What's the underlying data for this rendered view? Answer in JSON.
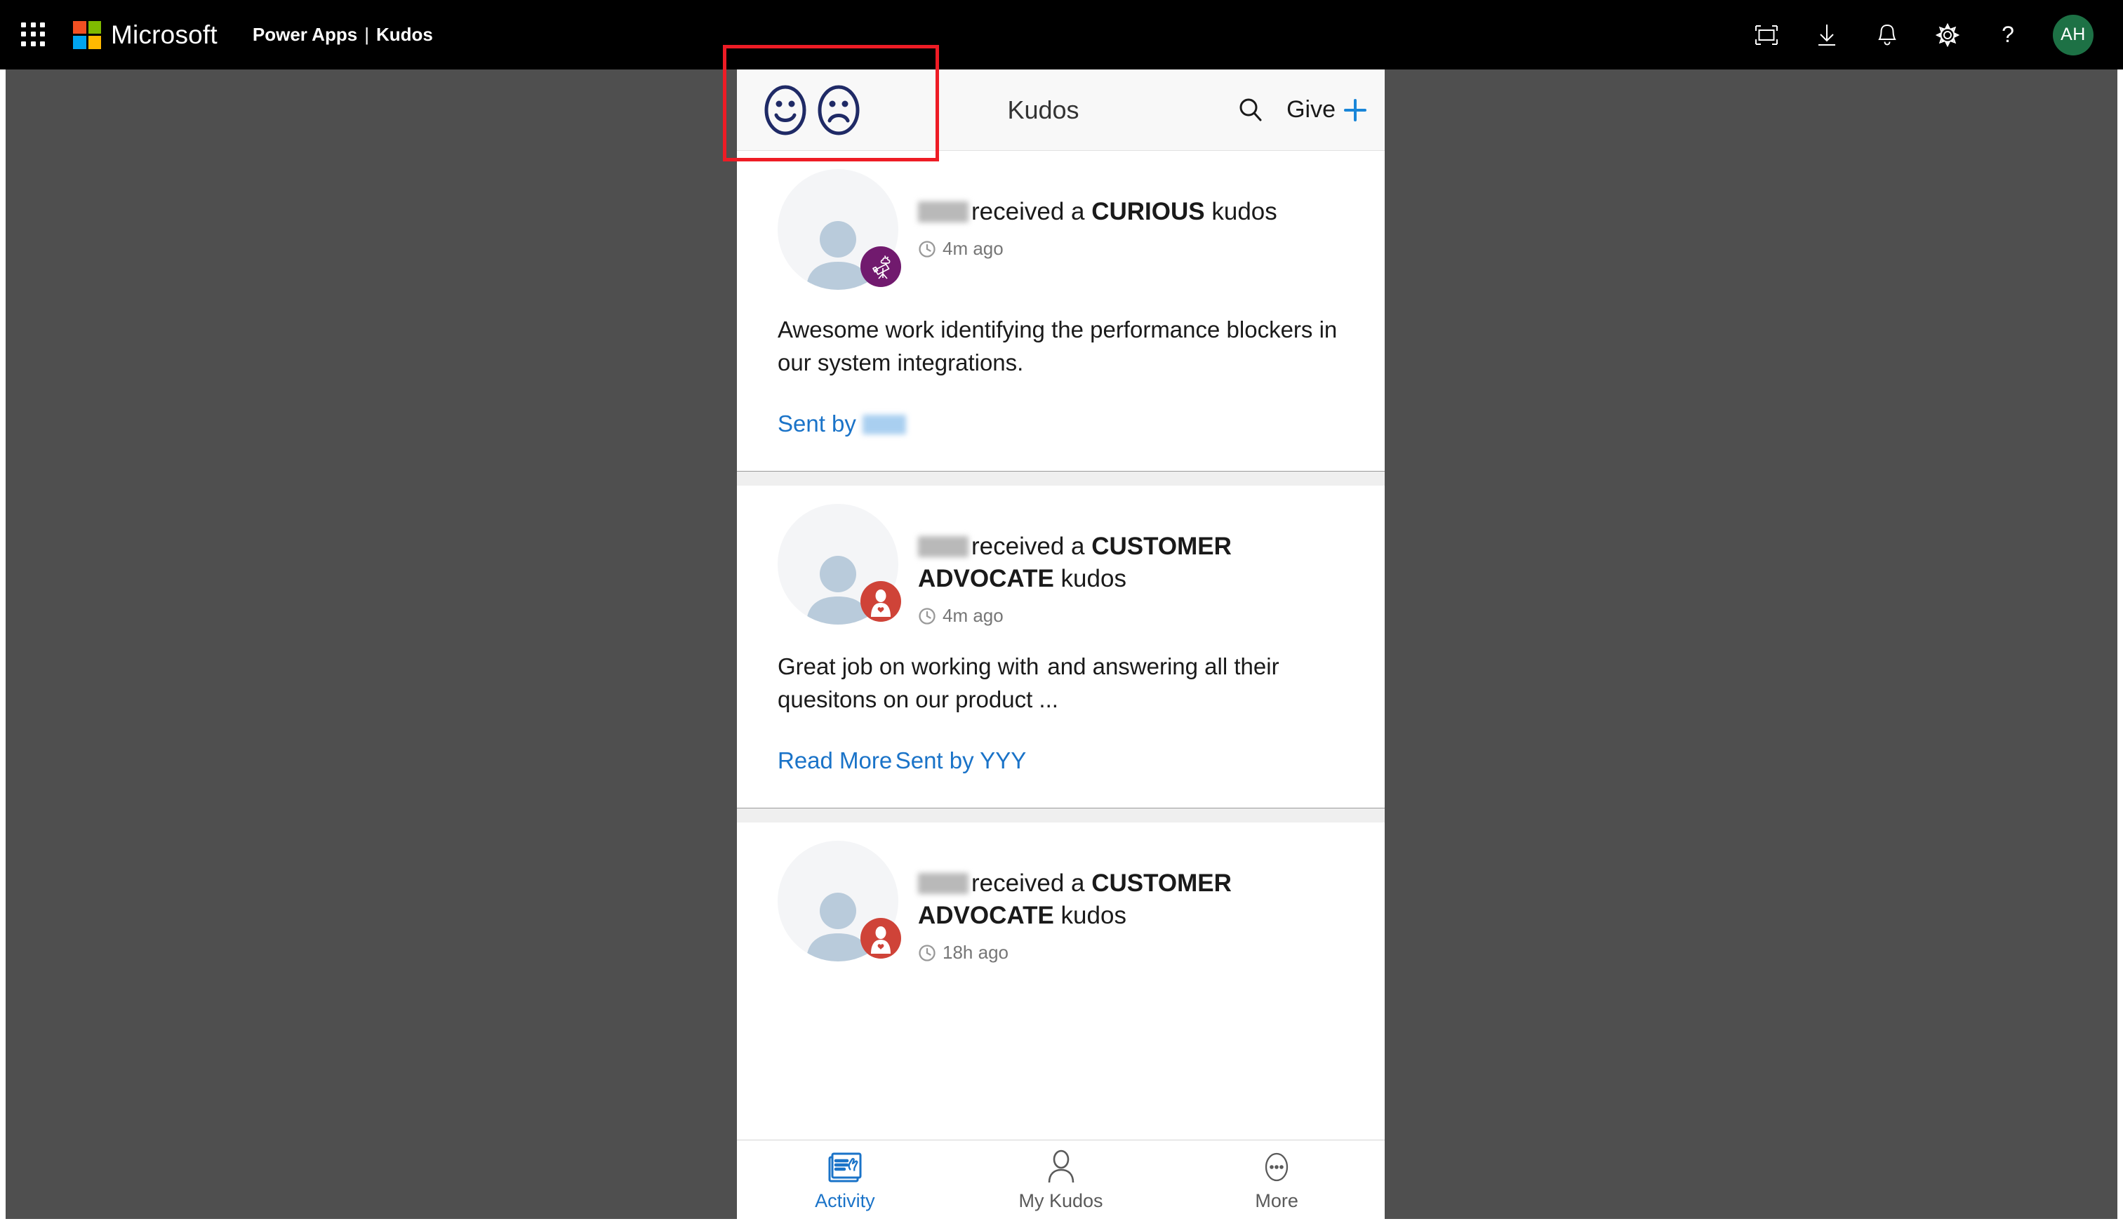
{
  "suite_bar": {
    "waffle_label": "app-launcher",
    "brand": "Microsoft",
    "product": "Power Apps",
    "divider": "|",
    "app": "Kudos",
    "icons": [
      {
        "name": "fit-to-screen-icon",
        "label": "Fit to screen"
      },
      {
        "name": "download-icon",
        "label": "Download"
      },
      {
        "name": "bell-icon",
        "label": "Notifications"
      },
      {
        "name": "gear-icon",
        "label": "Settings"
      },
      {
        "name": "help-icon",
        "label": "?"
      }
    ],
    "avatar_initials": "AH",
    "avatar_color": "#1d7145",
    "background": "#000000"
  },
  "app_header": {
    "title": "Kudos",
    "mood_happy": "happy-face-icon",
    "mood_sad": "sad-face-icon",
    "search_icon": "search-icon",
    "give_label": "Give",
    "give_plus": "plus-icon",
    "accent": "#1a73c8",
    "mood_color": "#1f2a66"
  },
  "feed": {
    "cards": [
      {
        "recipient": "",
        "received_text": "received a",
        "kudos_type": "CURIOUS",
        "kudos_suffix": "kudos",
        "time": "4m ago",
        "message": "Awesome work identifying the performance blockers in our system integrations.",
        "sent_by_label": "Sent by",
        "sent_by_name": "",
        "read_more": "",
        "badge": {
          "name": "telescope-badge-icon",
          "color": "#711a6e"
        }
      },
      {
        "recipient": "",
        "received_text": "received a",
        "kudos_type": "CUSTOMER ADVOCATE",
        "kudos_suffix": "kudos",
        "time": "4m ago",
        "message_pre": "Great job on working with",
        "message_post": "and answering all their quesitons on our product ...",
        "read_more": "Read More",
        "sent_by_full": "Sent by YYY",
        "badge": {
          "name": "customer-advocate-badge-icon",
          "color": "#cf4338"
        }
      },
      {
        "recipient": "",
        "received_text": "received a",
        "kudos_type": "CUSTOMER ADVOCATE",
        "kudos_suffix": "kudos",
        "time": "18h ago",
        "badge": {
          "name": "customer-advocate-badge-icon",
          "color": "#cf4338"
        }
      }
    ]
  },
  "bottom_nav": {
    "items": [
      {
        "label": "Activity",
        "icon": "activity-feed-icon",
        "active": true
      },
      {
        "label": "My Kudos",
        "icon": "person-icon",
        "active": false
      },
      {
        "label": "More",
        "icon": "more-ellipsis-icon",
        "active": false
      }
    ]
  },
  "annotation": {
    "color": "#ee1c25",
    "target": "mood-icons-region"
  }
}
